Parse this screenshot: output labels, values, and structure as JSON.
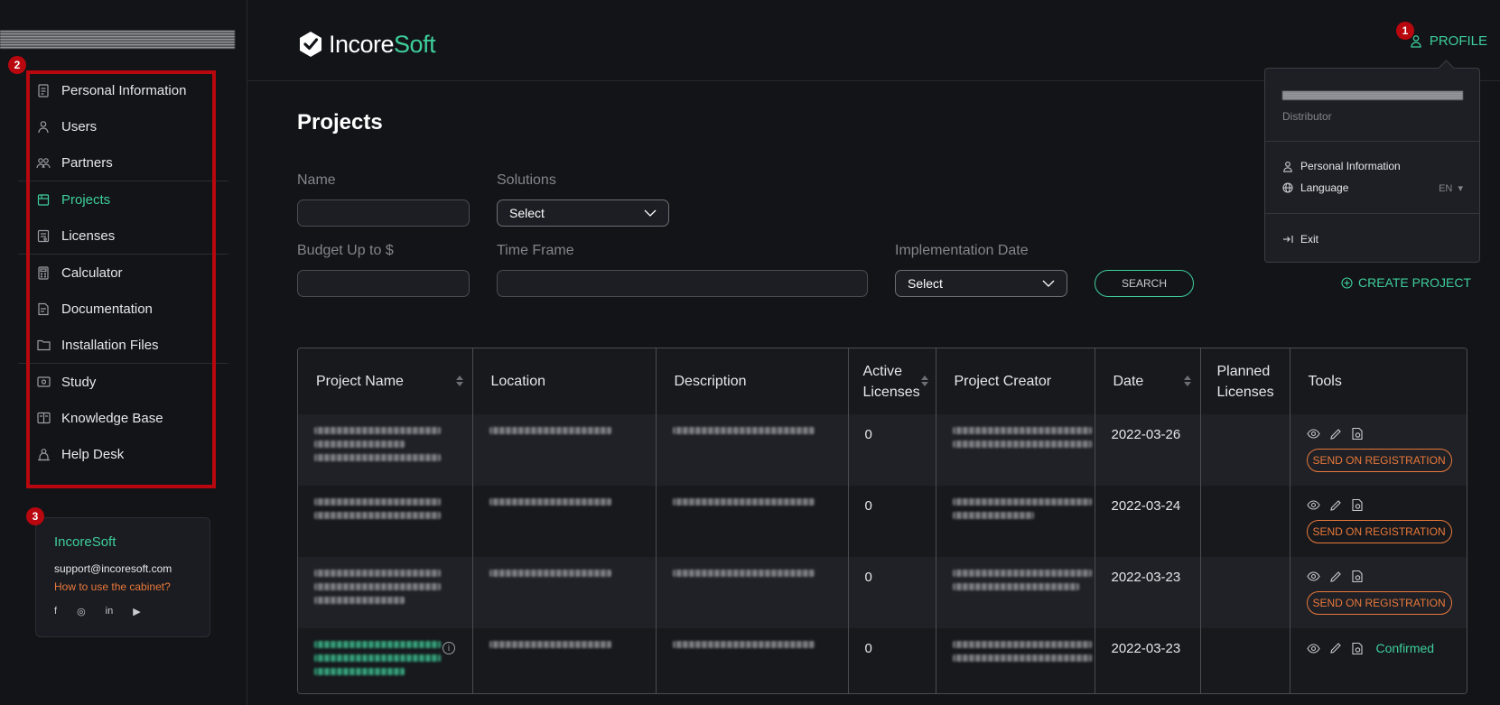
{
  "brand": {
    "logo_main": "Incore",
    "logo_accent": "Soft"
  },
  "header": {
    "profile_label": "PROFILE"
  },
  "badges": [
    "1",
    "2",
    "3"
  ],
  "sidebar": {
    "groups": [
      [
        {
          "label": "Personal Information",
          "icon": "id-card-icon"
        },
        {
          "label": "Users",
          "icon": "user-icon"
        },
        {
          "label": "Partners",
          "icon": "partners-icon"
        }
      ],
      [
        {
          "label": "Projects",
          "icon": "projects-icon",
          "active": true
        },
        {
          "label": "Licenses",
          "icon": "license-icon"
        }
      ],
      [
        {
          "label": "Calculator",
          "icon": "calculator-icon"
        },
        {
          "label": "Documentation",
          "icon": "document-icon"
        },
        {
          "label": "Installation Files",
          "icon": "folder-icon"
        }
      ],
      [
        {
          "label": "Study",
          "icon": "study-icon"
        },
        {
          "label": "Knowledge Base",
          "icon": "book-icon"
        },
        {
          "label": "Help Desk",
          "icon": "helpdesk-icon"
        }
      ]
    ]
  },
  "support": {
    "brand": "IncoreSoft",
    "email": "support@incoresoft.com",
    "howto": "How to use the cabinet?",
    "social": [
      "f",
      "◎",
      "in",
      "▶"
    ]
  },
  "profile_menu": {
    "role": "Distributor",
    "personal_info": "Personal Information",
    "language": "Language",
    "language_value": "EN",
    "exit": "Exit"
  },
  "page": {
    "title": "Projects",
    "filters": {
      "name_label": "Name",
      "solutions_label": "Solutions",
      "solutions_value": "Select",
      "budget_label": "Budget Up to $",
      "timeframe_label": "Time Frame",
      "impl_label": "Implementation Date",
      "impl_value": "Select",
      "search_label": "SEARCH",
      "create_label": "CREATE PROJECT"
    }
  },
  "table": {
    "headers": [
      "Project Name",
      "Location",
      "Description",
      "Active Licenses",
      "Project Creator",
      "Date",
      "Planned Licenses",
      "Tools"
    ],
    "rows": [
      {
        "active": "0",
        "date": "2022-03-26",
        "status": "SEND ON REGISTRATION"
      },
      {
        "active": "0",
        "date": "2022-03-24",
        "status": "SEND ON REGISTRATION"
      },
      {
        "active": "0",
        "date": "2022-03-23",
        "status": "SEND ON REGISTRATION"
      },
      {
        "active": "0",
        "date": "2022-03-23",
        "status": "Confirmed"
      }
    ]
  },
  "colors": {
    "accent": "#3ecf9b",
    "warning": "#e9783b",
    "highlight": "#b8070e",
    "background": "#131418"
  }
}
